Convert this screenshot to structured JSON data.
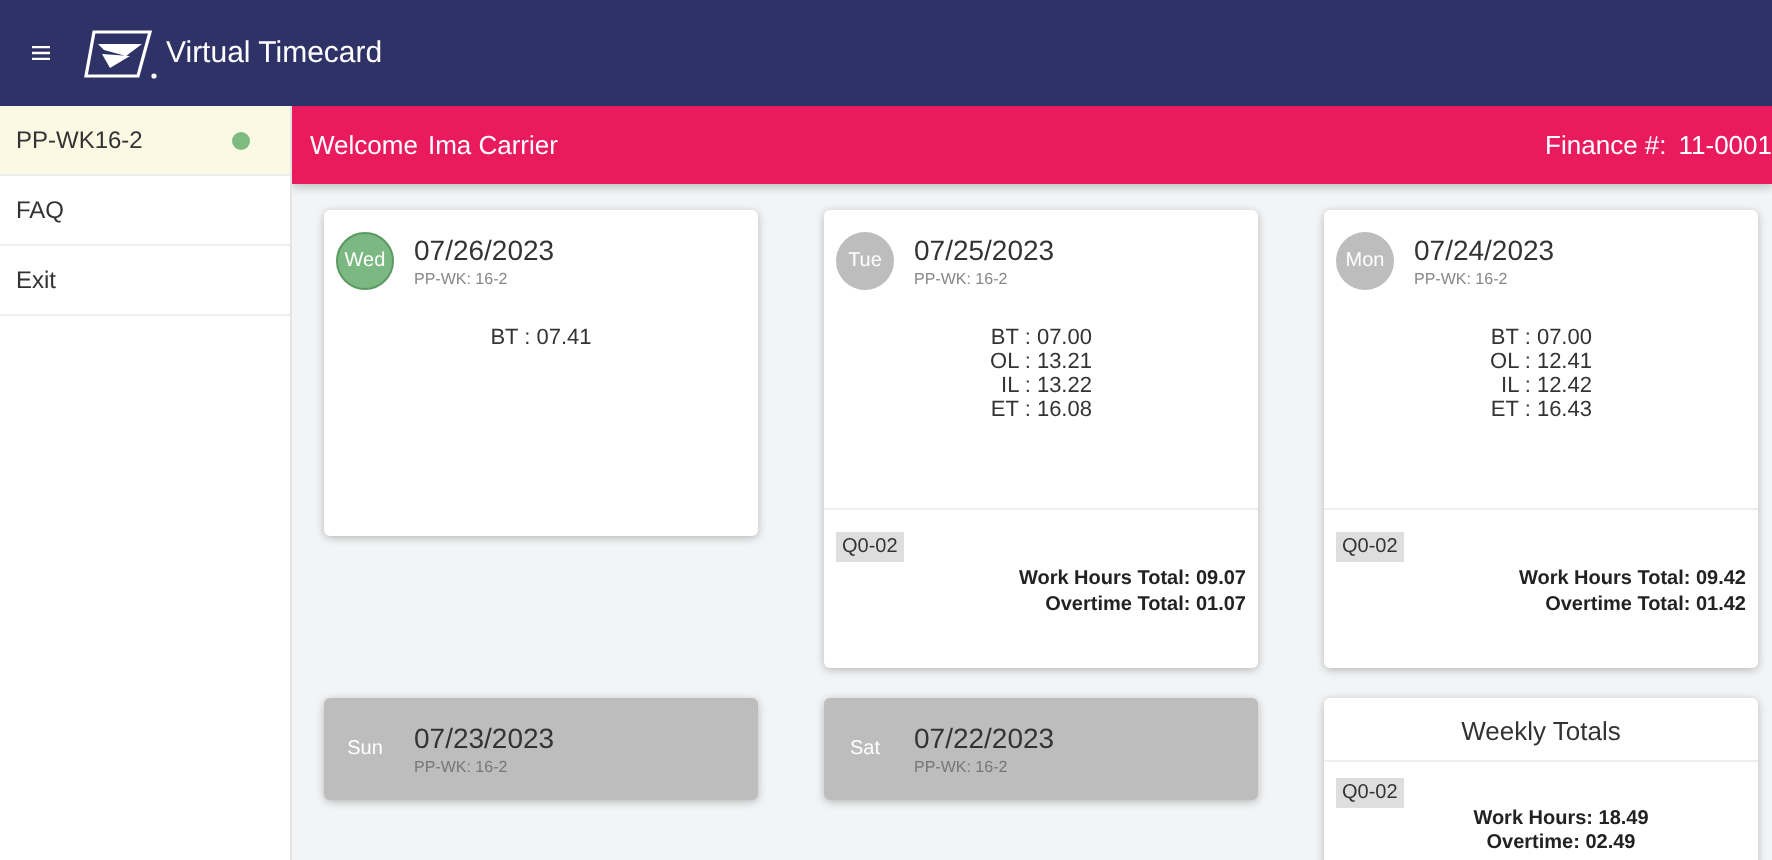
{
  "header": {
    "title": "Virtual Timecard"
  },
  "sidebar": {
    "items": [
      {
        "label": "PP-WK16-2",
        "selected": true,
        "dot": true
      },
      {
        "label": "FAQ",
        "selected": false,
        "dot": false
      },
      {
        "label": "Exit",
        "selected": false,
        "dot": false
      }
    ]
  },
  "welcome_bar": {
    "label": "Welcome",
    "name": "Ima Carrier",
    "finance_label": "Finance #:",
    "finance_value": "11-0001"
  },
  "days": [
    {
      "kind": "today",
      "day": "Wed",
      "date": "07/26/2023",
      "period": "PP-WK: 16-2",
      "punches": [
        "BT : 07.41"
      ]
    },
    {
      "kind": "worked",
      "day": "Tue",
      "date": "07/25/2023",
      "period": "PP-WK: 16-2",
      "punches": [
        "BT : 07.00",
        "OL : 13.21",
        "IL : 13.22",
        "ET : 16.08"
      ],
      "code": "Q0-02",
      "totals": [
        "Work Hours Total: 09.07",
        "Overtime Total: 01.07"
      ]
    },
    {
      "kind": "worked",
      "day": "Mon",
      "date": "07/24/2023",
      "period": "PP-WK: 16-2",
      "punches": [
        "BT : 07.00",
        "OL : 12.41",
        "IL : 12.42",
        "ET : 16.43"
      ],
      "code": "Q0-02",
      "totals": [
        "Work Hours Total: 09.42",
        "Overtime Total: 01.42"
      ]
    },
    {
      "kind": "off",
      "day": "Sun",
      "date": "07/23/2023",
      "period": "PP-WK: 16-2"
    },
    {
      "kind": "off",
      "day": "Sat",
      "date": "07/22/2023",
      "period": "PP-WK: 16-2"
    }
  ],
  "weekly_totals": {
    "title": "Weekly Totals",
    "code": "Q0-02",
    "totals": [
      "Work Hours: 18.49",
      "Overtime: 02.49"
    ]
  }
}
